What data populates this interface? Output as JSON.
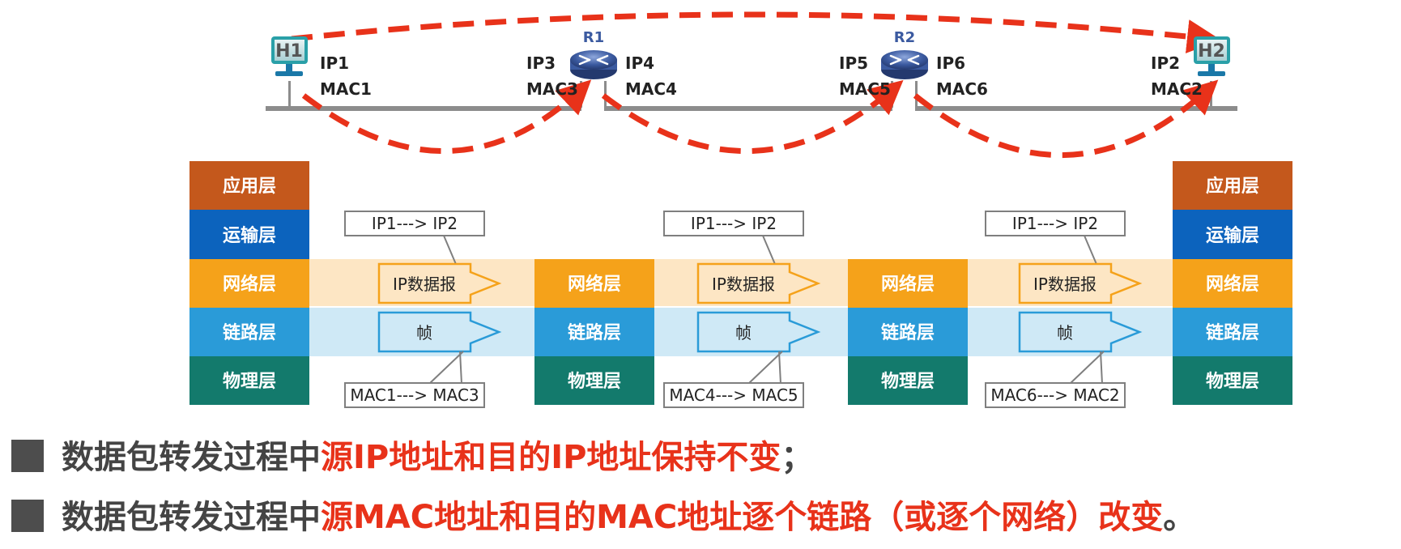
{
  "routers": [
    {
      "label": "R1",
      "left_ip": "IP3",
      "left_mac": "MAC3",
      "right_ip": "IP4",
      "right_mac": "MAC4"
    },
    {
      "label": "R2",
      "left_ip": "IP5",
      "left_mac": "MAC5",
      "right_ip": "IP6",
      "right_mac": "MAC6"
    }
  ],
  "hosts": [
    {
      "label": "H1",
      "ip": "IP1",
      "mac": "MAC1"
    },
    {
      "label": "H2",
      "ip": "IP2",
      "mac": "MAC2"
    }
  ],
  "layers": {
    "application": "应用层",
    "transport": "运输层",
    "network": "网络层",
    "link": "链路层",
    "physical": "物理层"
  },
  "hops": [
    {
      "ip_callout": "IP1---> IP2",
      "packet": "IP数据报",
      "frame": "帧",
      "mac_callout": "MAC1---> MAC3"
    },
    {
      "ip_callout": "IP1---> IP2",
      "packet": "IP数据报",
      "frame": "帧",
      "mac_callout": "MAC4---> MAC5"
    },
    {
      "ip_callout": "IP1---> IP2",
      "packet": "IP数据报",
      "frame": "帧",
      "mac_callout": "MAC6---> MAC2"
    }
  ],
  "notes": [
    {
      "prefix": "数据包转发过程中",
      "highlight": "源IP地址和目的IP地址保持不变",
      "suffix": "；"
    },
    {
      "prefix": "数据包转发过程中",
      "highlight": "源MAC地址和目的MAC地址逐个链路（或逐个网络）改变",
      "suffix": "。"
    }
  ],
  "colors": {
    "application": "#c4581c",
    "transport": "#0c63bd",
    "network": "#f5a21a",
    "link": "#2a9bd8",
    "physical": "#137a6c",
    "network_band": "#fde6c4",
    "link_band": "#cfe9f6",
    "arrow_red": "#e8321a",
    "router": "#3b5aa0",
    "host_teal": "#2aa0a8"
  }
}
